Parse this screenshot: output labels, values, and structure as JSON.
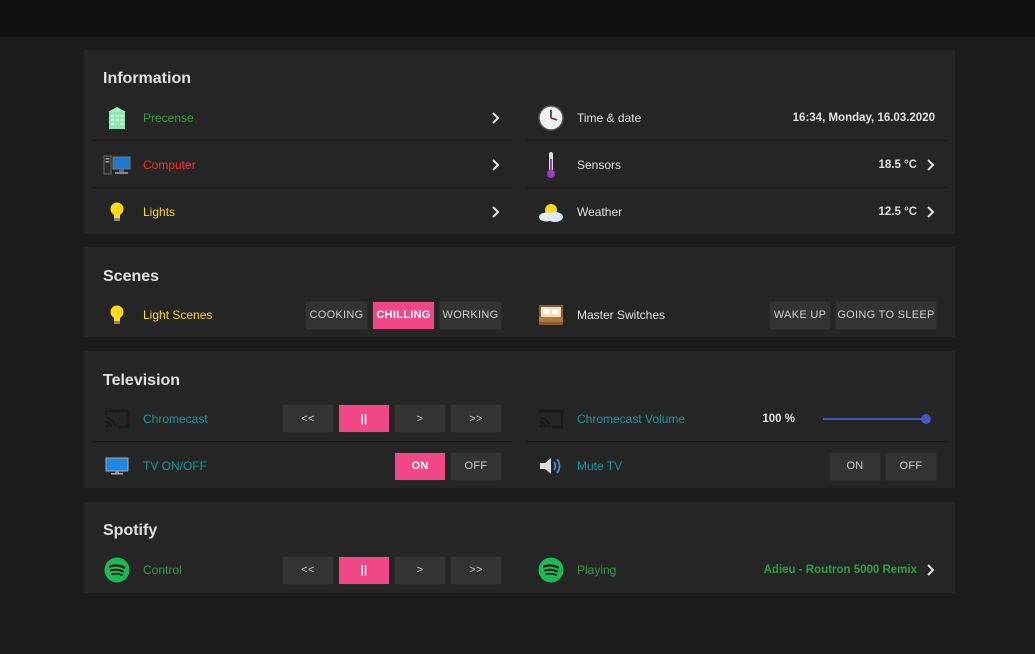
{
  "colors": {
    "accent": "#f14786",
    "presence": "#2ea043",
    "computer": "#ff2b2b",
    "lights": "#ffd91a",
    "tv": "#1a9aa0",
    "slider": "#4458c0"
  },
  "information": {
    "title": "Information",
    "presence": {
      "label": "Precense",
      "icon": "building-icon"
    },
    "computer": {
      "label": "Computer",
      "icon": "computer-icon"
    },
    "lights": {
      "label": "Lights",
      "icon": "lightbulb-icon"
    },
    "time": {
      "label": "Time & date",
      "value": "16:34, Monday, 16.03.2020",
      "icon": "clock-icon"
    },
    "sensors": {
      "label": "Sensors",
      "value": "18.5 °C",
      "icon": "thermometer-icon"
    },
    "weather": {
      "label": "Weather",
      "value": "12.5 °C",
      "icon": "weather-icon"
    }
  },
  "scenes": {
    "title": "Scenes",
    "light_scenes": {
      "label": "Light Scenes",
      "buttons": [
        "COOKING",
        "CHILLING",
        "WORKING"
      ],
      "active": "CHILLING"
    },
    "master": {
      "label": "Master Switches",
      "buttons": [
        "WAKE UP",
        "GOING TO SLEEP"
      ]
    }
  },
  "television": {
    "title": "Television",
    "chromecast": {
      "label": "Chromecast",
      "buttons": [
        "<<",
        "||",
        ">",
        ">>"
      ]
    },
    "volume": {
      "label": "Chromecast Volume",
      "value": "100 %",
      "level_percent": 100
    },
    "tv_onoff": {
      "label": "TV ON/OFF",
      "on": "ON",
      "off": "OFF",
      "state": "ON"
    },
    "mute": {
      "label": "Mute TV",
      "on": "ON",
      "off": "OFF"
    }
  },
  "spotify": {
    "title": "Spotify",
    "control": {
      "label": "Control",
      "buttons": [
        "<<",
        "||",
        ">",
        ">>"
      ]
    },
    "playing": {
      "label": "Playing",
      "value": "Adieu - Routron 5000 Remix"
    }
  }
}
